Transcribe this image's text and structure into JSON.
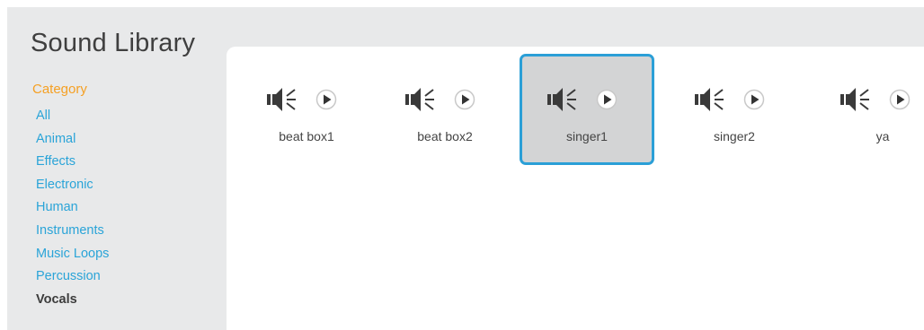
{
  "header": {
    "title": "Sound Library"
  },
  "sidebar": {
    "heading": "Category",
    "items": [
      {
        "label": "All"
      },
      {
        "label": "Animal"
      },
      {
        "label": "Effects"
      },
      {
        "label": "Electronic"
      },
      {
        "label": "Human"
      },
      {
        "label": "Instruments"
      },
      {
        "label": "Music Loops"
      },
      {
        "label": "Percussion"
      },
      {
        "label": "Vocals",
        "selected": true
      }
    ]
  },
  "sounds": [
    {
      "name": "beat box1",
      "icon": "speaker-icon",
      "action_icon": "play-icon"
    },
    {
      "name": "beat box2",
      "icon": "speaker-icon",
      "action_icon": "play-icon"
    },
    {
      "name": "singer1",
      "icon": "speaker-icon",
      "action_icon": "play-icon",
      "selected": true
    },
    {
      "name": "singer2",
      "icon": "speaker-icon",
      "action_icon": "play-icon"
    },
    {
      "name": "ya",
      "icon": "speaker-icon",
      "action_icon": "play-icon"
    }
  ],
  "colors": {
    "accent": "#f5a023",
    "link": "#2aa4d8",
    "selection_border": "#2b9fd7",
    "selection_fill": "#d3d4d5",
    "panel": "#e8e9ea"
  }
}
